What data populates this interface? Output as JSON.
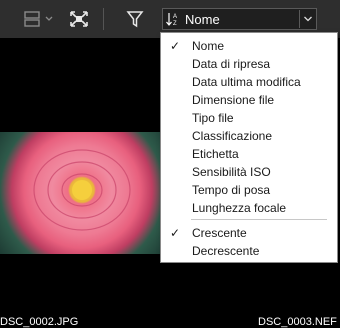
{
  "toolbar": {
    "sort_label": "Nome"
  },
  "sort_menu": {
    "fields": [
      {
        "label": "Nome",
        "checked": true
      },
      {
        "label": "Data di ripresa",
        "checked": false
      },
      {
        "label": "Data ultima modifica",
        "checked": false
      },
      {
        "label": "Dimensione file",
        "checked": false
      },
      {
        "label": "Tipo file",
        "checked": false
      },
      {
        "label": "Classificazione",
        "checked": false
      },
      {
        "label": "Etichetta",
        "checked": false
      },
      {
        "label": "Sensibilità ISO",
        "checked": false
      },
      {
        "label": "Tempo di posa",
        "checked": false
      },
      {
        "label": "Lunghezza focale",
        "checked": false
      }
    ],
    "order": [
      {
        "label": "Crescente",
        "checked": true
      },
      {
        "label": "Decrescente",
        "checked": false
      }
    ],
    "check_glyph": "✓"
  },
  "thumbnails": [
    {
      "filename": "DSC_0002.JPG"
    },
    {
      "filename": "DSC_0003.NEF"
    }
  ]
}
